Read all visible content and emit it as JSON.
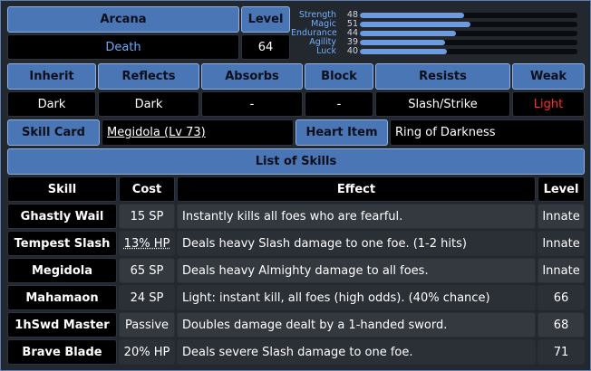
{
  "header": {
    "arcana_label": "Arcana",
    "arcana_value": "Death",
    "level_label": "Level",
    "level_value": "64"
  },
  "stats": [
    {
      "name": "Strength",
      "value": "48",
      "fraction": 0.48
    },
    {
      "name": "Magic",
      "value": "51",
      "fraction": 0.51
    },
    {
      "name": "Endurance",
      "value": "44",
      "fraction": 0.44
    },
    {
      "name": "Agility",
      "value": "39",
      "fraction": 0.39
    },
    {
      "name": "Luck",
      "value": "40",
      "fraction": 0.4
    }
  ],
  "affinities": {
    "headers": [
      "Inherit",
      "Reflects",
      "Absorbs",
      "Block",
      "Resists",
      "Weak"
    ],
    "values": [
      "Dark",
      "Dark",
      "-",
      "-",
      "Slash/Strike",
      "Light"
    ]
  },
  "skill_card": {
    "label": "Skill Card",
    "value": "Megidola (Lv 73)"
  },
  "heart_item": {
    "label": "Heart Item",
    "value": "Ring of Darkness"
  },
  "skills": {
    "title": "List of Skills",
    "columns": [
      "Skill",
      "Cost",
      "Effect",
      "Level"
    ],
    "rows": [
      {
        "skill": "Ghastly Wail",
        "cost": "15 SP",
        "effect": "Instantly kills all foes who are fearful.",
        "level": "Innate"
      },
      {
        "skill": "Tempest Slash",
        "cost": "13% HP",
        "effect": "Deals heavy Slash damage to one foe. (1-2 hits)",
        "level": "Innate"
      },
      {
        "skill": "Megidola",
        "cost": "65 SP",
        "effect": "Deals heavy Almighty damage to all foes.",
        "level": "Innate"
      },
      {
        "skill": "Mahamaon",
        "cost": "24 SP",
        "effect": "Light: instant kill, all foes (high odds). (40% chance)",
        "level": "66"
      },
      {
        "skill": "1hSwd Master",
        "cost": "Passive",
        "effect": "Doubles damage dealt by a 1-handed sword.",
        "level": "68"
      },
      {
        "skill": "Brave Blade",
        "cost": "20% HP",
        "effect": "Deals severe Slash damage to one foe.",
        "level": "71"
      }
    ]
  },
  "colors": {
    "header_blue": "#4a76b5",
    "value_black": "#000000",
    "accent_text_blue": "#6aaaf6",
    "weak_red": "#ff2d2d",
    "stat_bar": "#6e9be0"
  }
}
